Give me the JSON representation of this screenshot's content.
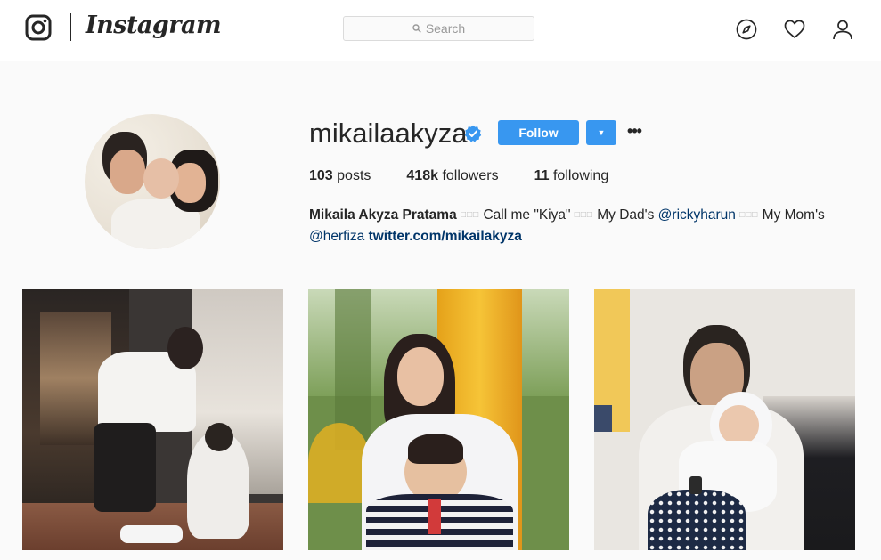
{
  "nav": {
    "logo_icon": "instagram-camera-icon",
    "wordmark": "Instagram",
    "search_placeholder": "Search",
    "icons": [
      "compass-icon",
      "heart-icon",
      "person-icon"
    ]
  },
  "profile": {
    "username": "mikailaakyza",
    "verified": true,
    "follow_label": "Follow",
    "more_label": "•••",
    "stats": {
      "posts_count": "103",
      "posts_label": "posts",
      "followers_count": "418k",
      "followers_label": "followers",
      "following_count": "11",
      "following_label": "following"
    },
    "bio": {
      "full_name": "Mikaila Akyza Pratama",
      "sep": "□□□",
      "part1": "Call me \"Kiya\"",
      "part2": "My Dad's",
      "mention_dad": "@rickyharun",
      "part3": "My Mom's",
      "mention_mom": "@herfiza",
      "url": "twitter.com/mikailakyza"
    }
  },
  "colors": {
    "accent": "#3897f0",
    "link": "#003569",
    "text": "#262626",
    "background": "#fafafa"
  }
}
